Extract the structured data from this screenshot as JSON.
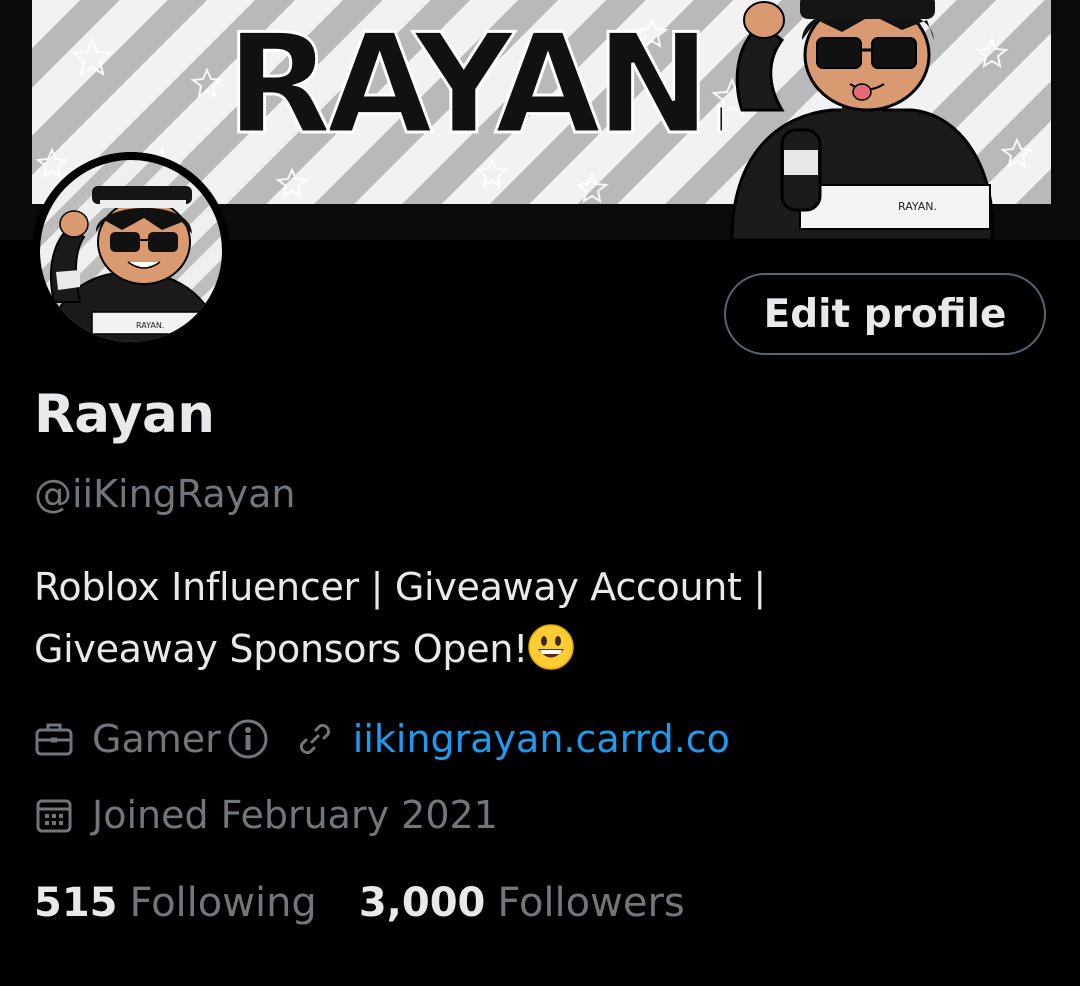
{
  "banner": {
    "title": "RAYAN."
  },
  "profile": {
    "edit_button_label": "Edit profile",
    "display_name": "Rayan",
    "handle": "@iiKingRayan",
    "bio_line1": "Roblox Influencer | Giveaway Account |",
    "bio_line2": "Giveaway Sponsors Open!",
    "bio_emoji": "grinning-face-emoji",
    "category": "Gamer",
    "link": "iikingrayan.carrd.co",
    "joined": "Joined February 2021"
  },
  "stats": {
    "following_count": "515",
    "following_label": "Following",
    "followers_count": "3,000",
    "followers_label": "Followers"
  },
  "icons": {
    "category": "briefcase-icon",
    "info": "info-icon",
    "link": "link-icon",
    "joined": "calendar-icon"
  },
  "colors": {
    "background": "#000000",
    "primary_text": "#e7e9ea",
    "secondary_text": "#71767b",
    "link": "#1d9bf0",
    "button_border": "#536471"
  }
}
